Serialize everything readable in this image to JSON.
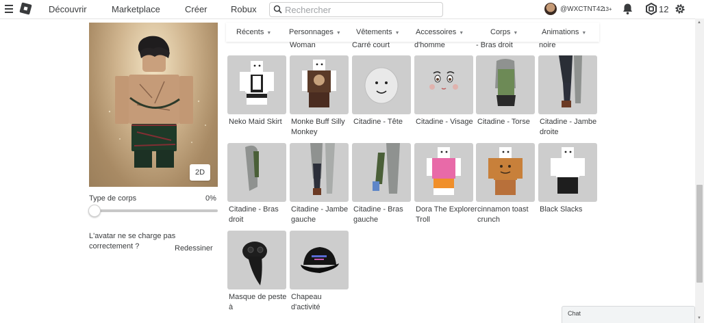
{
  "topbar": {
    "menu_icon": "hamburger-icon",
    "logo_icon": "roblox-logo-icon",
    "nav": [
      "Découvrir",
      "Marketplace",
      "Créer",
      "Robux"
    ],
    "search_placeholder": "Rechercher",
    "username": "@WXCTNT42",
    "age_tag": "13+",
    "robux_count": "12",
    "icons": [
      "search-icon",
      "notification-bell-icon",
      "robux-icon",
      "settings-gear-icon"
    ]
  },
  "avatar_panel": {
    "view_toggle": "2D",
    "body_type_label": "Type de corps",
    "body_type_value": "0%",
    "body_type_fraction": 0.0,
    "help_text": "L'avatar ne se charge pas correctement ?",
    "redraw_label": "Redessiner"
  },
  "tabs": [
    {
      "label": "Récents"
    },
    {
      "label": "Personnages"
    },
    {
      "label": "Vêtements"
    },
    {
      "label": "Accessoires"
    },
    {
      "label": "Corps"
    },
    {
      "label": "Animations"
    }
  ],
  "overflow_row": [
    "Woman",
    "Carré court",
    "d'homme",
    "- Bras droit",
    "noire"
  ],
  "items": [
    {
      "name": "Neko Maid Skirt",
      "icon": "maid-outfit-thumbnail"
    },
    {
      "name": "Monke Buff Silly Monkey",
      "icon": "monkey-shirt-thumbnail"
    },
    {
      "name": "Citadine - Tête",
      "icon": "head-thumbnail"
    },
    {
      "name": "Citadine - Visage",
      "icon": "face-thumbnail"
    },
    {
      "name": "Citadine - Torse",
      "icon": "torso-thumbnail"
    },
    {
      "name": "Citadine - Jambe droite",
      "icon": "right-leg-thumbnail"
    },
    {
      "name": "Citadine - Bras droit",
      "icon": "right-arm-thumbnail"
    },
    {
      "name": "Citadine - Jambe gauche",
      "icon": "left-leg-thumbnail"
    },
    {
      "name": "Citadine - Bras gauche",
      "icon": "left-arm-thumbnail"
    },
    {
      "name": "Dora The Explorer Troll",
      "icon": "dora-outfit-thumbnail"
    },
    {
      "name": "cinnamon toast crunch",
      "icon": "cereal-shirt-thumbnail"
    },
    {
      "name": "Black Slacks",
      "icon": "black-slacks-thumbnail"
    },
    {
      "name": "Masque de peste à",
      "icon": "plague-mask-thumbnail"
    },
    {
      "name": "Chapeau d'activité",
      "icon": "cap-thumbnail"
    }
  ],
  "chat": {
    "label": "Chat"
  },
  "colors": {
    "thumb_bg": "#cdcdcd",
    "text": "#393b3d",
    "accent": "#393b3d"
  }
}
